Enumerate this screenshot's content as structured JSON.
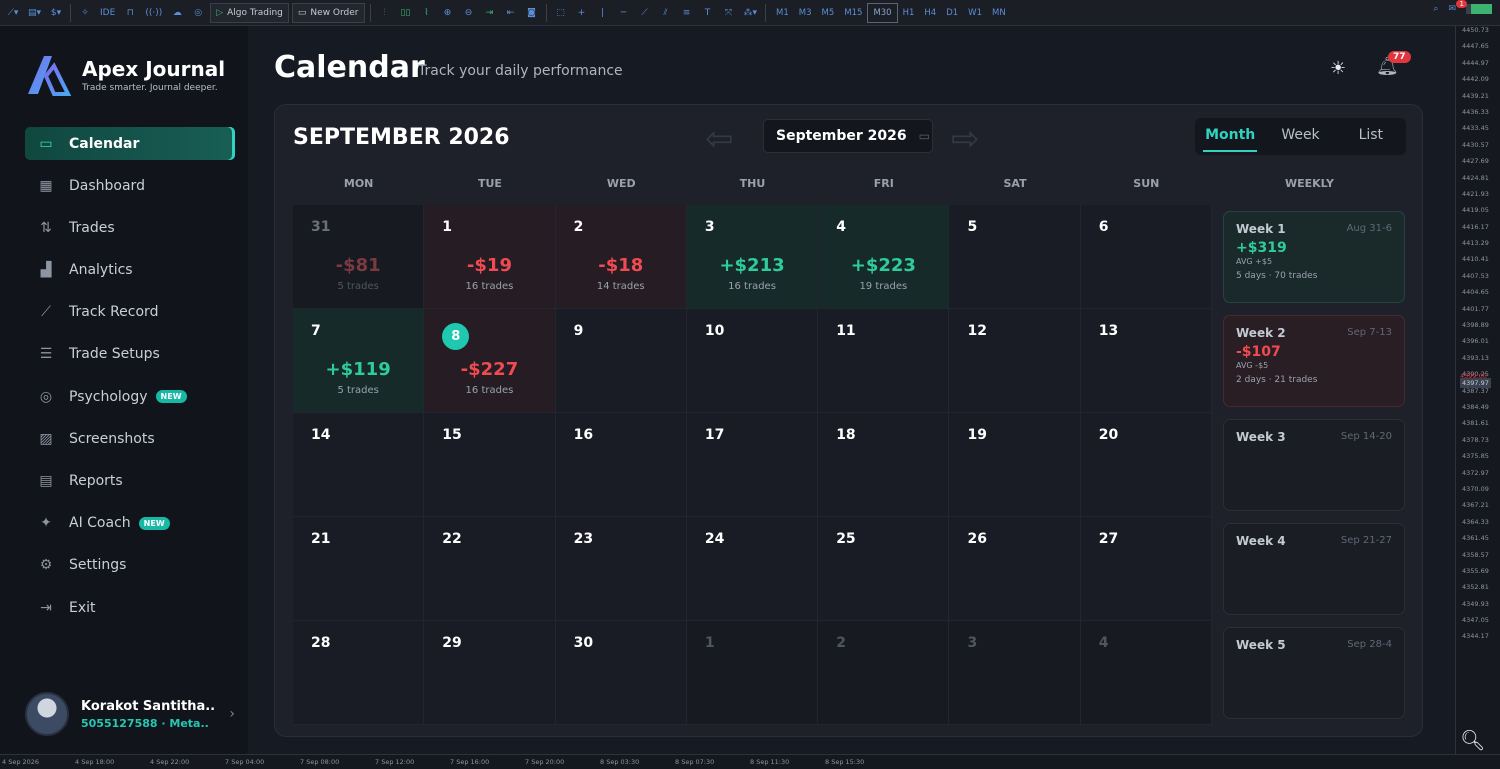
{
  "toolbar": {
    "algo_trading": "Algo Trading",
    "new_order": "New Order",
    "ide": "IDE",
    "timeframes": [
      "M1",
      "M3",
      "M5",
      "M15",
      "M30",
      "H1",
      "H4",
      "D1",
      "W1",
      "MN"
    ],
    "active_timeframe": "M30",
    "notification_count": "1"
  },
  "app": {
    "name": "Apex Journal",
    "tagline": "Trade smarter. Journal deeper."
  },
  "nav": [
    {
      "label": "Calendar",
      "icon": "calendar-icon",
      "active": true
    },
    {
      "label": "Dashboard",
      "icon": "grid-icon"
    },
    {
      "label": "Trades",
      "icon": "trades-icon"
    },
    {
      "label": "Analytics",
      "icon": "bar-chart-icon"
    },
    {
      "label": "Track Record",
      "icon": "line-chart-icon"
    },
    {
      "label": "Trade Setups",
      "icon": "sliders-icon"
    },
    {
      "label": "Psychology",
      "icon": "brain-icon",
      "badge": "NEW"
    },
    {
      "label": "Screenshots",
      "icon": "image-icon"
    },
    {
      "label": "Reports",
      "icon": "report-icon"
    },
    {
      "label": "AI Coach",
      "icon": "sparkle-icon",
      "badge": "NEW"
    },
    {
      "label": "Settings",
      "icon": "gear-icon"
    },
    {
      "label": "Exit",
      "icon": "exit-icon"
    }
  ],
  "user": {
    "name": "Korakot Santitha..",
    "meta": "5055127588 · Meta.."
  },
  "header": {
    "title": "Calendar",
    "subtitle": "Track your daily performance",
    "notifications": "77"
  },
  "calendar": {
    "month_title": "SEPTEMBER 2026",
    "picker_value": "September 2026",
    "views": [
      "Month",
      "Week",
      "List"
    ],
    "active_view": "Month",
    "days_of_week": [
      "MON",
      "TUE",
      "WED",
      "THU",
      "FRI",
      "SAT",
      "SUN",
      "WEEKLY"
    ],
    "days": [
      {
        "d": "31",
        "pnl": "-$81",
        "trades": "5 trades",
        "state": "faded"
      },
      {
        "d": "1",
        "pnl": "-$19",
        "trades": "16 trades",
        "state": "neg"
      },
      {
        "d": "2",
        "pnl": "-$18",
        "trades": "14 trades",
        "state": "neg"
      },
      {
        "d": "3",
        "pnl": "+$213",
        "trades": "16 trades",
        "state": "pos"
      },
      {
        "d": "4",
        "pnl": "+$223",
        "trades": "19 trades",
        "state": "pos"
      },
      {
        "d": "5",
        "state": "normal"
      },
      {
        "d": "6",
        "state": "normal"
      },
      {
        "d": "7",
        "pnl": "+$119",
        "trades": "5 trades",
        "state": "pos"
      },
      {
        "d": "8",
        "pnl": "-$227",
        "trades": "16 trades",
        "state": "neg",
        "today": true
      },
      {
        "d": "9",
        "state": "normal"
      },
      {
        "d": "10",
        "state": "normal"
      },
      {
        "d": "11",
        "state": "normal"
      },
      {
        "d": "12",
        "state": "normal"
      },
      {
        "d": "13",
        "state": "normal"
      },
      {
        "d": "14",
        "state": "normal"
      },
      {
        "d": "15",
        "state": "normal"
      },
      {
        "d": "16",
        "state": "normal"
      },
      {
        "d": "17",
        "state": "normal"
      },
      {
        "d": "18",
        "state": "normal"
      },
      {
        "d": "19",
        "state": "normal"
      },
      {
        "d": "20",
        "state": "normal"
      },
      {
        "d": "21",
        "state": "normal"
      },
      {
        "d": "22",
        "state": "normal"
      },
      {
        "d": "23",
        "state": "normal"
      },
      {
        "d": "24",
        "state": "normal"
      },
      {
        "d": "25",
        "state": "normal"
      },
      {
        "d": "26",
        "state": "normal"
      },
      {
        "d": "27",
        "state": "normal"
      },
      {
        "d": "28",
        "state": "normal"
      },
      {
        "d": "29",
        "state": "normal"
      },
      {
        "d": "30",
        "state": "normal"
      },
      {
        "d": "1",
        "state": "muted"
      },
      {
        "d": "2",
        "state": "muted"
      },
      {
        "d": "3",
        "state": "muted"
      },
      {
        "d": "4",
        "state": "muted"
      }
    ],
    "weeks": [
      {
        "name": "Week 1",
        "range": "Aug 31-6",
        "pnl": "+$319",
        "avg": "AVG +$5",
        "stats": "5 days · 70 trades",
        "state": "wpos"
      },
      {
        "name": "Week 2",
        "range": "Sep 7-13",
        "pnl": "-$107",
        "avg": "AVG -$5",
        "stats": "2 days · 21 trades",
        "state": "wneg"
      },
      {
        "name": "Week 3",
        "range": "Sep 14-20",
        "state": "none"
      },
      {
        "name": "Week 4",
        "range": "Sep 21-27",
        "state": "none"
      },
      {
        "name": "Week 5",
        "range": "Sep 28-4",
        "state": "none"
      }
    ]
  },
  "price_scale": [
    "4450.73",
    "4447.65",
    "4444.97",
    "4442.09",
    "4439.21",
    "4436.33",
    "4433.45",
    "4430.57",
    "4427.69",
    "4424.81",
    "4421.93",
    "4419.05",
    "4416.17",
    "4413.29",
    "4410.41",
    "4407.53",
    "4404.65",
    "4401.77",
    "4398.89",
    "4396.01",
    "4393.13",
    "4390.25",
    "4387.37",
    "4384.49",
    "4381.61",
    "4378.73",
    "4375.85",
    "4372.97",
    "4370.09",
    "4367.21",
    "4364.33",
    "4361.45",
    "4358.57",
    "4355.69",
    "4352.81",
    "4349.93",
    "4347.05",
    "4344.17"
  ],
  "current_price": "4397.97",
  "price_red": "4399.00",
  "time_axis": [
    "4 Sep 2026",
    "4 Sep 18:00",
    "4 Sep 22:00",
    "7 Sep 04:00",
    "7 Sep 08:00",
    "7 Sep 12:00",
    "7 Sep 16:00",
    "7 Sep 20:00",
    "8 Sep 03:30",
    "8 Sep 07:30",
    "8 Sep 11:30",
    "8 Sep 15:30"
  ]
}
